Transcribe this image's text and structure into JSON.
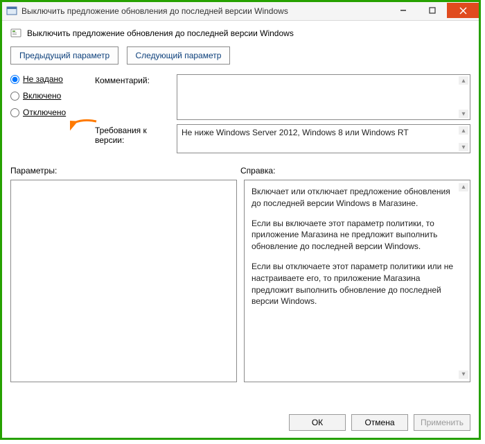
{
  "titlebar": {
    "title": "Выключить предложение обновления до последней версии Windows"
  },
  "header": {
    "text": "Выключить предложение обновления до последней версии Windows"
  },
  "nav": {
    "prev": "Предыдущий параметр",
    "next": "Следующий параметр"
  },
  "radios": {
    "not_configured": "Не задано",
    "enabled": "Включено",
    "disabled": "Отключено"
  },
  "labels": {
    "comment": "Комментарий:",
    "requirements": "Требования к версии:",
    "options": "Параметры:",
    "help": "Справка:"
  },
  "requirements_text": "Не ниже Windows Server 2012, Windows 8 или Windows RT",
  "help_text": {
    "p1": "Включает или отключает предложение обновления до последней версии Windows в Магазине.",
    "p2": "Если вы включаете этот параметр политики, то приложение Магазина не предложит выполнить обновление до последней версии Windows.",
    "p3": "Если вы отключаете этот параметр политики или не настраиваете его, то приложение Магазина предложит выполнить обновление до последней версии Windows."
  },
  "footer": {
    "ok": "ОК",
    "cancel": "Отмена",
    "apply": "Применить"
  }
}
